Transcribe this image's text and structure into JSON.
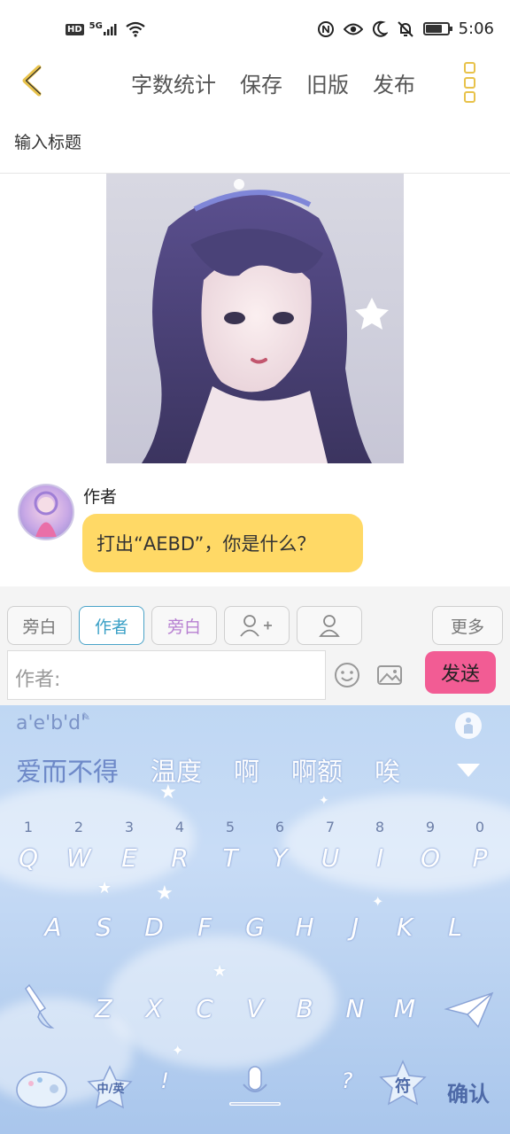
{
  "status_bar": {
    "network_badge": "HD",
    "network_type": "5G",
    "time": "5:06",
    "icons": [
      "signal-icon",
      "wifi-icon",
      "nfc-icon",
      "eye-icon",
      "moon-icon",
      "bell-off-icon",
      "battery-icon"
    ]
  },
  "toolbar": {
    "actions": [
      "字数统计",
      "保存",
      "旧版",
      "发布"
    ],
    "accent_color": "#e8c24a"
  },
  "title_placeholder": "输入标题",
  "message": {
    "author": "作者",
    "text": "打出“AEBD”，你是什么？",
    "bubble_color": "#ffd966"
  },
  "roles": {
    "items": [
      "旁白",
      "作者",
      "旁白"
    ],
    "more": "更多"
  },
  "composer": {
    "prefix": "作者:",
    "send": "发送",
    "send_color": "#f25c94"
  },
  "keyboard": {
    "pinyin": "a'e'b'd'",
    "candidates": [
      "爱而不得",
      "温度",
      "啊",
      "啊额",
      "唉"
    ],
    "numbers": [
      "1",
      "2",
      "3",
      "4",
      "5",
      "6",
      "7",
      "8",
      "9",
      "0"
    ],
    "row1": [
      "Q",
      "W",
      "E",
      "R",
      "T",
      "Y",
      "U",
      "I",
      "O",
      "P"
    ],
    "row2": [
      "A",
      "S",
      "D",
      "F",
      "G",
      "H",
      "J",
      "K",
      "L"
    ],
    "row3": [
      "Z",
      "X",
      "C",
      "V",
      "B",
      "N",
      "M"
    ],
    "lang_key": "中/英",
    "punct_left": "!",
    "punct_right": "?",
    "symbol_key": "符",
    "enter_key": "确认"
  }
}
